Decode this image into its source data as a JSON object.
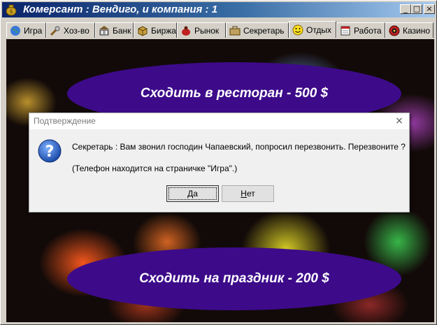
{
  "window": {
    "title": "Комерсант : Вендиго, и компания : 1",
    "controls": {
      "minimize": "_",
      "maximize": "□",
      "close": "×"
    }
  },
  "tabs": [
    {
      "label": "Игра",
      "icon": "globe-icon"
    },
    {
      "label": "Хоз-во",
      "icon": "tools-icon"
    },
    {
      "label": "Банк",
      "icon": "bank-icon"
    },
    {
      "label": "Биржа",
      "icon": "box-icon"
    },
    {
      "label": "Рынок",
      "icon": "market-bag-icon"
    },
    {
      "label": "Секретарь",
      "icon": "briefcase-icon"
    },
    {
      "label": "Отдых",
      "icon": "smiley-icon",
      "active": true
    },
    {
      "label": "Работа",
      "icon": "calendar-icon"
    },
    {
      "label": "Казино",
      "icon": "roulette-icon"
    }
  ],
  "main": {
    "restaurant_button": "Сходить в ресторан - 500 $",
    "party_button": "Сходить на праздник - 200 $"
  },
  "dialog": {
    "title": "Подтверждение",
    "icon": "question-icon",
    "message": "Секретарь : Вам звонил господин Чапаевский, попросил перезвонить. Перезвоните ?",
    "note": "(Телефон находится на страничке \"Игра\".)",
    "yes_accel": "Д",
    "yes_rest": "а",
    "no_accel": "Н",
    "no_rest": "ет",
    "close": "×"
  },
  "colors": {
    "title_gradient_start": "#0a246a",
    "title_gradient_end": "#a6caf0",
    "oval_fill": "#3d0a8a",
    "window_face": "#d4d0c8"
  }
}
